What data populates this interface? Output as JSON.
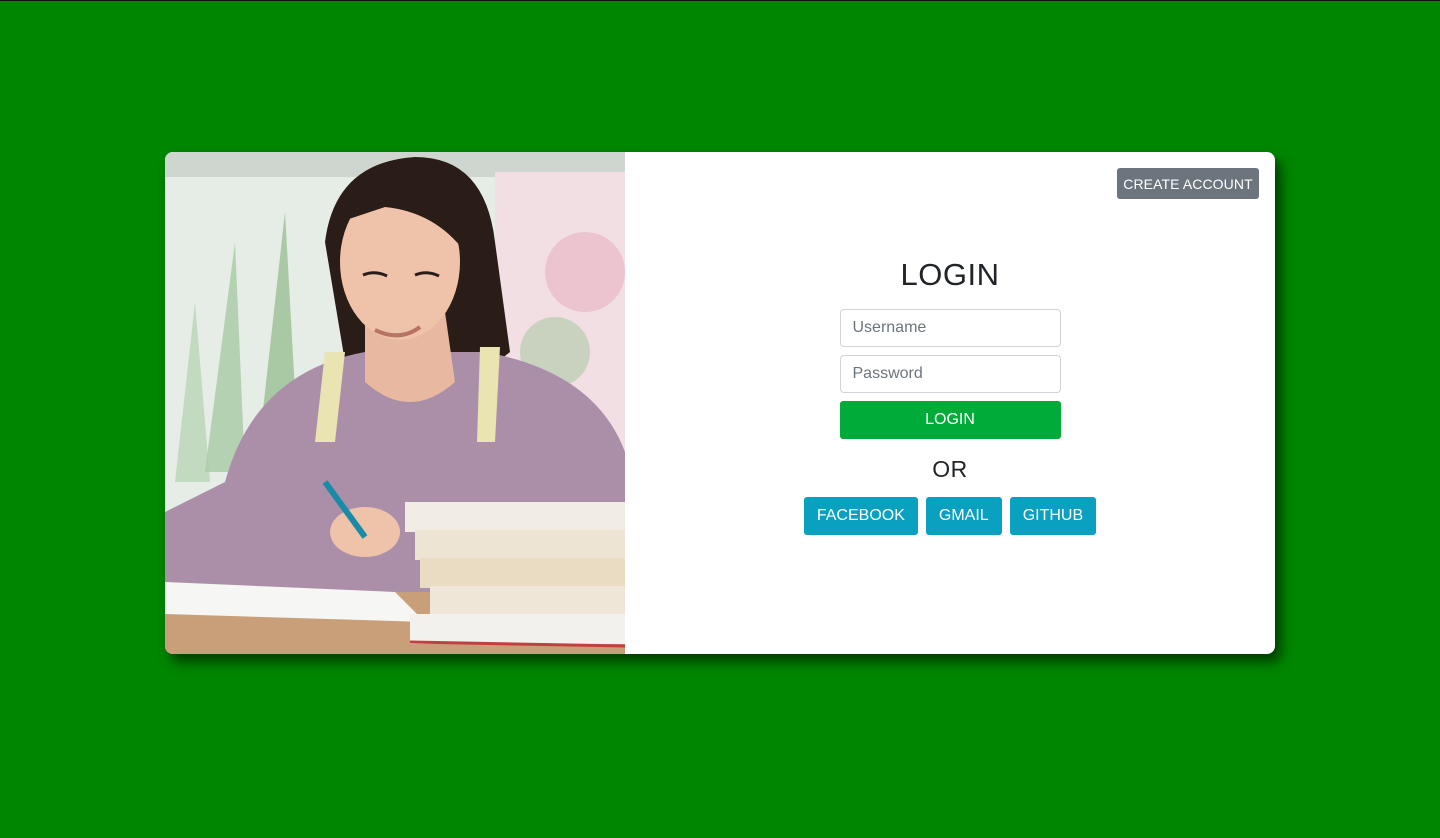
{
  "colors": {
    "background": "#008600",
    "login_button": "#00ab3a",
    "social_button": "#0aa0bf",
    "create_account_button": "#6c757d"
  },
  "header": {
    "create_account_label": "CREATE ACCOUNT"
  },
  "login": {
    "title": "LOGIN",
    "username_placeholder": "Username",
    "username_value": "",
    "password_placeholder": "Password",
    "password_value": "",
    "submit_label": "LOGIN",
    "separator": "OR"
  },
  "social": {
    "buttons": [
      {
        "label": "FACEBOOK"
      },
      {
        "label": "GMAIL"
      },
      {
        "label": "GITHUB"
      }
    ]
  },
  "photo": {
    "icon": "student-studying-image"
  }
}
